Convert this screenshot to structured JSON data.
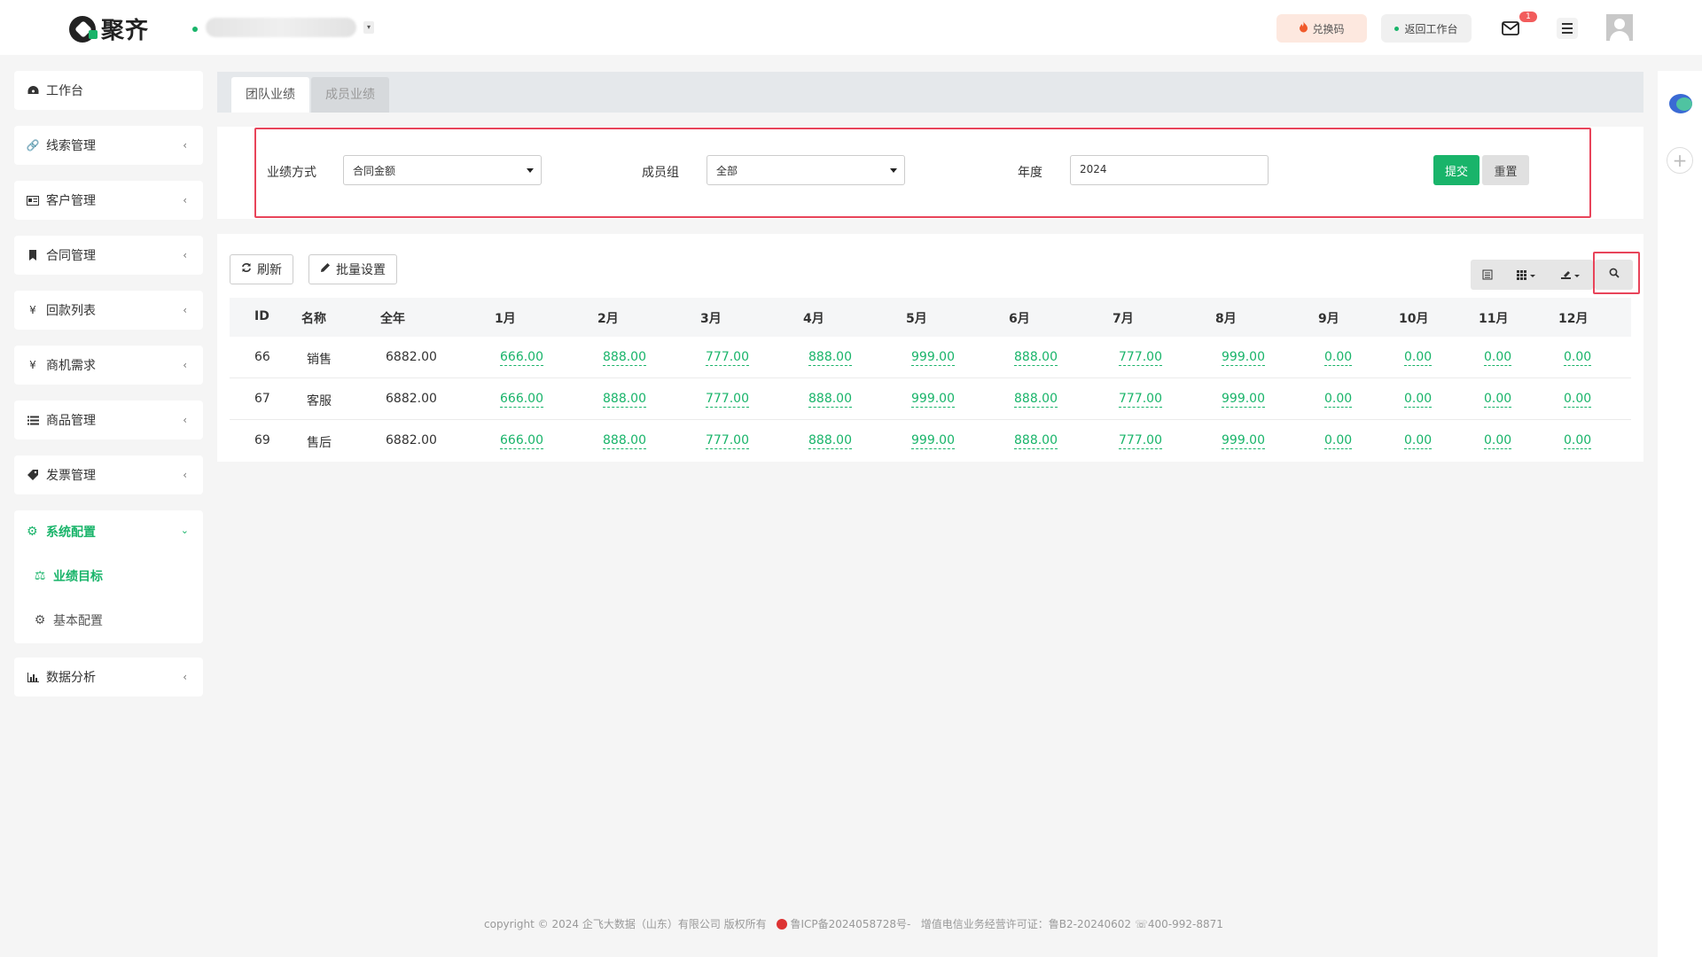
{
  "header": {
    "logo_text": "聚齐",
    "company_caret": "▾",
    "redeem_label": "兑换码",
    "back_label": "返回工作台",
    "mail_badge": "1"
  },
  "sidebar": {
    "items": [
      {
        "label": "工作台",
        "icon": "dashboard-icon"
      },
      {
        "label": "线索管理",
        "icon": "link-icon"
      },
      {
        "label": "客户管理",
        "icon": "id-card-icon"
      },
      {
        "label": "合同管理",
        "icon": "bookmark-icon"
      },
      {
        "label": "回款列表",
        "icon": "yen-icon"
      },
      {
        "label": "商机需求",
        "icon": "yen-icon"
      },
      {
        "label": "商品管理",
        "icon": "list-icon"
      },
      {
        "label": "发票管理",
        "icon": "tag-icon"
      },
      {
        "label": "数据分析",
        "icon": "bar-chart-icon"
      }
    ],
    "system": {
      "label": "系统配置",
      "icon": "cogs-icon",
      "sub": [
        {
          "label": "业绩目标",
          "icon": "scale-icon"
        },
        {
          "label": "基本配置",
          "icon": "gear-icon"
        }
      ]
    }
  },
  "tabs": [
    {
      "label": "团队业绩"
    },
    {
      "label": "成员业绩"
    }
  ],
  "filter": {
    "method_label": "业绩方式",
    "method_value": "合同金额",
    "group_label": "成员组",
    "group_value": "全部",
    "year_label": "年度",
    "year_value": "2024",
    "submit_label": "提交",
    "reset_label": "重置"
  },
  "toolbar": {
    "refresh_label": "刷新",
    "batch_label": "批量设置"
  },
  "table": {
    "columns": [
      "ID",
      "名称",
      "全年",
      "1月",
      "2月",
      "3月",
      "4月",
      "5月",
      "6月",
      "7月",
      "8月",
      "9月",
      "10月",
      "11月",
      "12月"
    ],
    "rows": [
      {
        "id": "66",
        "name": "销售",
        "total": "6882.00",
        "months": [
          "666.00",
          "888.00",
          "777.00",
          "888.00",
          "999.00",
          "888.00",
          "777.00",
          "999.00",
          "0.00",
          "0.00",
          "0.00",
          "0.00"
        ]
      },
      {
        "id": "67",
        "name": "客服",
        "total": "6882.00",
        "months": [
          "666.00",
          "888.00",
          "777.00",
          "888.00",
          "999.00",
          "888.00",
          "777.00",
          "999.00",
          "0.00",
          "0.00",
          "0.00",
          "0.00"
        ]
      },
      {
        "id": "69",
        "name": "售后",
        "total": "6882.00",
        "months": [
          "666.00",
          "888.00",
          "777.00",
          "888.00",
          "999.00",
          "888.00",
          "777.00",
          "999.00",
          "0.00",
          "0.00",
          "0.00",
          "0.00"
        ]
      }
    ]
  },
  "footer": {
    "copyright": "copyright © 2024 企飞大数据（山东）有限公司 版权所有",
    "icp": "鲁ICP备2024058728号-",
    "license": "增值电信业务经营许可证：鲁B2-20240602",
    "phone": "400-992-8871"
  },
  "colors": {
    "accent": "#19b46a",
    "highlight_border": "#e8445a"
  }
}
